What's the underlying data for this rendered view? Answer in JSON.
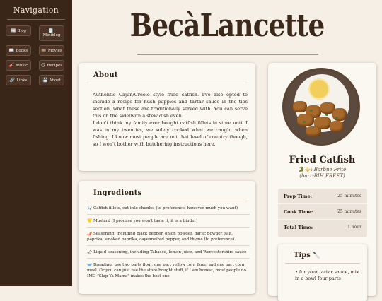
{
  "sidebar": {
    "title": "Navigation",
    "items": [
      {
        "icon": "📰",
        "label": "Blog"
      },
      {
        "icon": "🗒️",
        "label": "Miniblog"
      },
      {
        "icon": "📖",
        "label": "Books"
      },
      {
        "icon": "🎞️",
        "label": "Movies"
      },
      {
        "icon": "🎸",
        "label": "Music"
      },
      {
        "icon": "😋",
        "label": "Recipes"
      },
      {
        "icon": "🔗",
        "label": "Links"
      },
      {
        "icon": "💾",
        "label": "About"
      }
    ]
  },
  "masthead": {
    "title": "BecàLancette"
  },
  "about": {
    "heading": "About",
    "paragraphs": [
      "Authentic Cajun/Creole style fried catfish. I've also opted to include a recipe for hush puppies and tartar sauce in the tips section, what these are traditionally served with. You can serve this on the side/with a stew dish even.",
      "I don't think my family ever bought catfish fillets in store until I was in my twenties, we solely cooked what we caught when fishing. I know most people are not that level of country though, so I won't bother with butchering instructions here."
    ]
  },
  "ingredients": {
    "heading": "Ingredients",
    "items": [
      {
        "icon": "🎣",
        "text": "Catfish fillets, cut into chunks, (to preference, however much you want)"
      },
      {
        "icon": "💛",
        "text": "Mustard (I promise you won't taste it, it is a binder)"
      },
      {
        "icon": "🌶️",
        "text": "Seasoning, including black pepper, onion powder, garlic powder, salt, paprika, smoked paprika, cayenne/red pepper, and thyme (to preference)"
      },
      {
        "icon": "🌶",
        "text": "Liquid seasoning, including Tabasco, lemon juice, and Worcestershire sauce"
      },
      {
        "icon": "🥣",
        "text": "Breading, use two parts flour, one part yellow corn flour, and one part corn meal. Or you can just use the store-bought stuff, if I am honest, most people do. IMO \"Slap Ya Mama\" makes the best one"
      }
    ]
  },
  "recipe": {
    "title": "Fried Catfish",
    "subtitle_icons": "🐊⚜️",
    "subtitle": "Barbue Frite",
    "pronunciation": "(barr-BIH FREET)",
    "times": [
      {
        "label": "Prep Time:",
        "value": "25 minutes"
      },
      {
        "label": "Cook Time:",
        "value": "25 minutes"
      },
      {
        "label": "Total Time:",
        "value": "1 hour"
      }
    ],
    "tips": {
      "heading": "Tips",
      "icon": "🔪",
      "text": "• for your tartar sauce, mix in a bowl four parts"
    }
  }
}
